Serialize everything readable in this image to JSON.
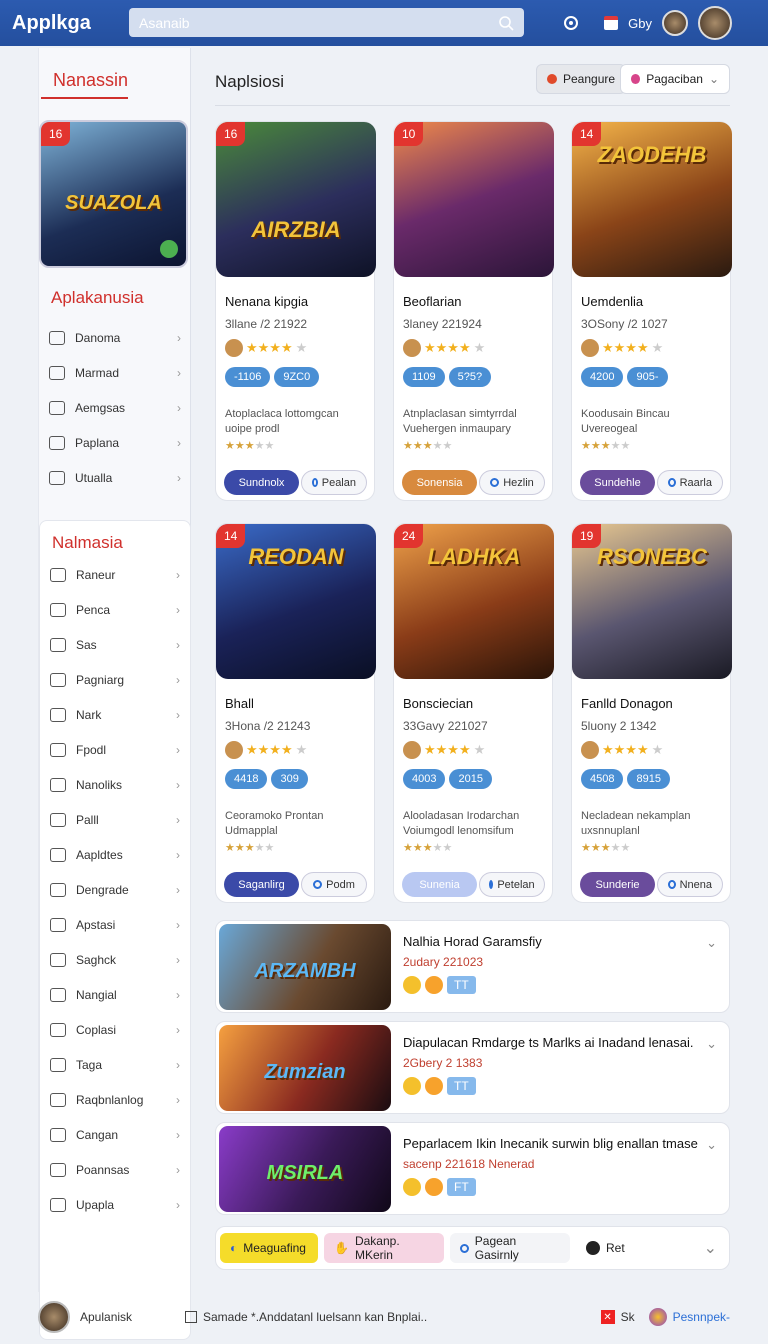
{
  "app": {
    "title": "Applkga"
  },
  "search": {
    "placeholder": "Asanaib"
  },
  "topbar": {
    "right_label": "Gby"
  },
  "sidebar": {
    "section1_title": "Nanassin",
    "section2_title": "Aplakanusia",
    "section2_items": [
      "Danoma",
      "Marmad",
      "Aemgsas",
      "Paplana",
      "Utualla"
    ],
    "section3_title": "Nalmasia",
    "section3_items": [
      "Raneur",
      "Penca",
      "Sas",
      "Pagniarg",
      "Nark",
      "Fpodl",
      "Nanoliks",
      "Palll",
      "Aapldtes",
      "Dengrade",
      "Apstasi",
      "Saghck",
      "Nangial",
      "Coplasi",
      "Taga",
      "Raqbnlanlog",
      "Cangan",
      "Poannsas",
      "Upapla"
    ],
    "feature_badge": "16",
    "feature_text": "SUAZOLA"
  },
  "main": {
    "heading": "Naplsiosi",
    "pill1": "Peangure",
    "pill2": "Pagaciban"
  },
  "cards": [
    {
      "badge": "16",
      "cover": "AIRZBIA",
      "title": "Nenana kipgia",
      "date": "3llane /2 21922",
      "tags": [
        "-1106",
        "9ZC0"
      ],
      "desc": "Atoplaclaca lottomgcan uoipe prodl",
      "primary": "Sundnolx",
      "secondary": "Pealan",
      "color": "#3b4aa8"
    },
    {
      "badge": "10",
      "cover": "",
      "title": "Beoflarian",
      "date": "3laney 221924",
      "tags": [
        "1109",
        "5?5?"
      ],
      "desc": "Atnplaclasan simtyrrdal Vuehergen inmaupary",
      "primary": "Sonensia",
      "secondary": "Hezlin",
      "color": "#d88a3e"
    },
    {
      "badge": "14",
      "cover": "ZAODEHB",
      "title": "Uemdenlia",
      "date": "3OSony /2 1027",
      "tags": [
        "4200",
        "905-"
      ],
      "desc": "Koodusain Bincau Uvereogeal",
      "primary": "Sundehle",
      "secondary": "Raarla",
      "color": "#6a4c9c"
    },
    {
      "badge": "14",
      "cover": "REODAN",
      "title": "Bhall",
      "date": "3Hona /2 21243",
      "tags": [
        "4418",
        "309"
      ],
      "desc": "Ceoramoko Prontan Udmapplal",
      "primary": "Saganlirg",
      "secondary": "Podm",
      "color": "#3b4aa8"
    },
    {
      "badge": "24",
      "cover": "LADHKA",
      "title": "Bonsciecian",
      "date": "33Gavy 221027",
      "tags": [
        "4003",
        "2015"
      ],
      "desc": "Alooladasan Irodarchan Voiumgodl lenomsifum",
      "primary": "Sunenia",
      "secondary": "Petelan",
      "color": "#b9c8f2"
    },
    {
      "badge": "19",
      "cover": "RSONEBC",
      "title": "Fanlld Donagon",
      "date": "5luony 2 1342",
      "tags": [
        "4508",
        "8915"
      ],
      "desc": "Necladean nekamplan uxsnnuplanl",
      "primary": "Sunderie",
      "secondary": "Nnena",
      "color": "#6a4c9c"
    }
  ],
  "rows": [
    {
      "title": "Nalhia Horad Garamsfiy",
      "sub": "2udary 221023",
      "tag": "TT",
      "cover": "ARZAMBH"
    },
    {
      "title": "Diapulacan Rmdarge ts Marlks ai Inadand lenasai.",
      "sub": "2Gbery 2 1383",
      "tag": "TT",
      "cover": "Zumzian"
    },
    {
      "title": "Peparlacem Ikin Inecanik surwin blig enallan tmase",
      "sub": "sacenp 221618 Nenerad",
      "tag": "FT",
      "cover": "MSIRLA"
    }
  ],
  "filters": [
    "Meaguafing",
    "Dakanp. MKerin",
    "Pagean Gasirnly",
    "Ret"
  ],
  "footer": {
    "user": "Apulanisk",
    "middle": "Samade *.Anddatanl luelsann kan Bnplai..",
    "sk": "Sk",
    "right": "Pesnnpek-"
  }
}
